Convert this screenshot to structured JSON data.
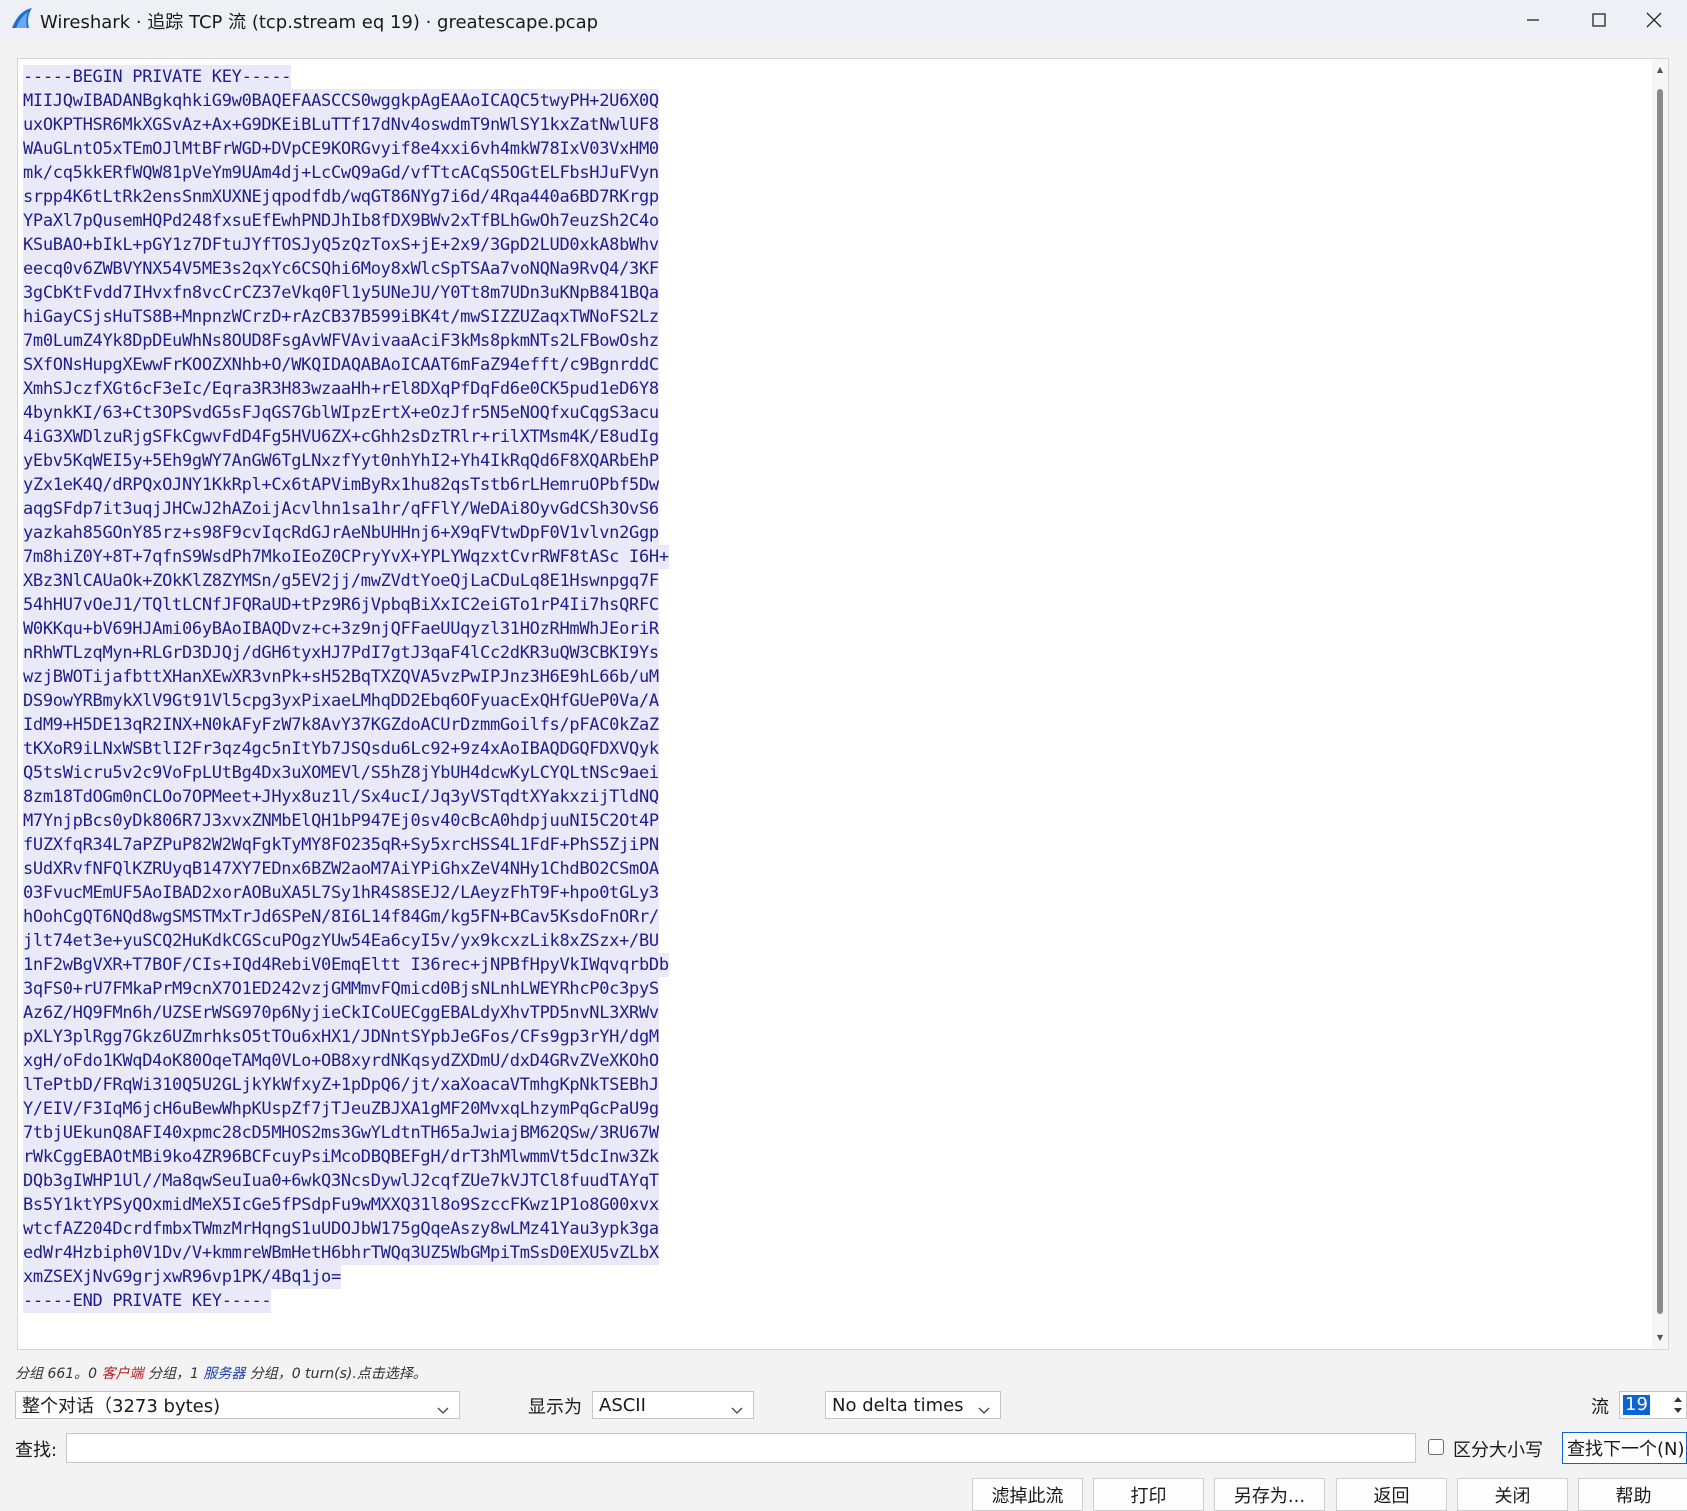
{
  "window": {
    "title": "Wireshark · 追踪 TCP 流 (tcp.stream eq 19) · greatescape.pcap",
    "minimize_icon": "minimize-icon",
    "maximize_icon": "maximize-icon",
    "close_icon": "close-icon",
    "app_icon": "wireshark-fin-icon"
  },
  "stream_lines": [
    "-----BEGIN PRIVATE KEY-----",
    "MIIJQwIBADANBgkqhkiG9w0BAQEFAASCCS0wggkpAgEAAoICAQC5twyPH+2U6X0Q",
    "uxOKPTHSR6MkXGSvAz+Ax+G9DKEiBLuTTf17dNv4oswdmT9nWlSY1kxZatNwlUF8",
    "WAuGLntO5xTEmOJlMtBFrWGD+DVpCE9KORGvyif8e4xxi6vh4mkW78IxV03VxHM0",
    "mk/cq5kkERfWQW81pVeYm9UAm4dj+LcCwQ9aGd/vfTtcACqS5OGtELFbsHJuFVyn",
    "srpp4K6tLtRk2ensSnmXUXNEjqpodfdb/wqGT86NYg7i6d/4Rqa440a6BD7RKrgp",
    "YPaXl7pQusemHQPd248fxsuEfEwhPNDJhIb8fDX9BWv2xTfBLhGwOh7euzSh2C4o",
    "KSuBAO+bIkL+pGY1z7DFtuJYfTOSJyQ5zQzToxS+jE+2x9/3GpD2LUD0xkA8bWhv",
    "eecq0v6ZWBVYNX54V5ME3s2qxYc6CSQhi6Moy8xWlcSpTSAa7voNQNa9RvQ4/3KF",
    "3gCbKtFvdd7IHvxfn8vcCrCZ37eVkq0Fl1y5UNeJU/Y0Tt8m7UDn3uKNpB841BQa",
    "hiGayCSjsHuTS8B+MnpnzWCrzD+rAzCB37B599iBK4t/mwSIZZUZaqxTWNoFS2Lz",
    "7m0LumZ4Yk8DpDEuWhNs8OUD8FsgAvWFVAvivaaAciF3kMs8pkmNTs2LFBowOshz",
    "SXfONsHupgXEwwFrKOOZXNhb+O/WKQIDAQABAoICAAT6mFaZ94efft/c9BgnrddC",
    "XmhSJczfXGt6cF3eIc/Eqra3R3H83wzaaHh+rEl8DXqPfDqFd6e0CK5pud1eD6Y8",
    "4bynkKI/63+Ct3OPSvdG5sFJqGS7GblWIpzErtX+eOzJfr5N5eNOQfxuCqgS3acu",
    "4iG3XWDlzuRjgSFkCgwvFdD4Fg5HVU6ZX+cGhh2sDzTRlr+rilXTMsm4K/E8udIg",
    "yEbv5KqWEI5y+5Eh9gWY7AnGW6TgLNxzfYyt0nhYhI2+Yh4IkRqQd6F8XQARbEhP",
    "yZx1eK4Q/dRPQxOJNY1KkRpl+Cx6tAPVimByRx1hu82qsTstb6rLHemruOPbf5Dw",
    "aqgSFdp7it3uqjJHCwJ2hAZoijAcvlhn1sa1hr/qFFlY/WeDAi8OyvGdCSh3OvS6",
    "yazkah85GOnY85rz+s98F9cvIqcRdGJrAeNbUHHnj6+X9qFVtwDpF0V1vlvn2Ggp",
    "7m8hiZ0Y+8T+7qfnS9WsdPh7MkoIEoZ0CPryYvX+YPLYWqzxtCvrRWF8tASc I6H+",
    "XBz3NlCAUaOk+ZOkKlZ8ZYMSn/g5EV2jj/mwZVdtYoeQjLaCDuLq8E1Hswnpgq7F",
    "54hHU7vOeJ1/TQltLCNfJFQRaUD+tPz9R6jVpbqBiXxIC2eiGTo1rP4Ii7hsQRFC",
    "W0KKqu+bV69HJAmi06yBAoIBAQDvz+c+3z9njQFFaeUUqyzl31HOzRHmWhJEoriR",
    "nRhWTLzqMyn+RLGrD3DJQj/dGH6tyxHJ7PdI7gtJ3qaF4lCc2dKR3uQW3CBKI9Ys",
    "wzjBWOTijafbttXHanXEwXR3vnPk+sH52BqTXZQVA5vzPwIPJnz3H6E9hL66b/uM",
    "DS9owYRBmykXlV9Gt91Vl5cpg3yxPixaeLMhqDD2Ebq6OFyuacExQHfGUeP0Va/A",
    "IdM9+H5DE13qR2INX+N0kAFyFzW7k8AvY37KGZdoACUrDzmmGoilfs/pFAC0kZaZ",
    "tKXoR9iLNxWSBtlI2Fr3qz4gc5nItYb7JSQsdu6Lc92+9z4xAoIBAQDGQFDXVQyk",
    "Q5tsWicru5v2c9VoFpLUtBg4Dx3uXOMEVl/S5hZ8jYbUH4dcwKyLCYQLtNSc9aei",
    "8zm18TdOGm0nCLOo7OPMeet+JHyx8uz1l/Sx4ucI/Jq3yVSTqdtXYakxzijTldNQ",
    "M7YnjpBcs0yDk806R7J3xvxZNMbElQH1bP947Ej0sv40cBcA0hdpjuuNI5C2Ot4P",
    "fUZXfqR34L7aPZPuP82W2WqFgkTyMY8FO235qR+Sy5xrcHSS4L1FdF+PhS5ZjiPN",
    "sUdXRvfNFQlKZRUyqB147XY7EDnx6BZW2aoM7AiYPiGhxZeV4NHy1ChdBO2CSmOA",
    "03FvucMEmUF5AoIBAD2xorAOBuXA5L7Sy1hR4S8SEJ2/LAeyzFhT9F+hpo0tGLy3",
    "hOohCgQT6NQd8wgSMSTMxTrJd6SPeN/8I6L14f84Gm/kg5FN+BCav5KsdoFnORr/",
    "jlt74et3e+yuSCQ2HuKdkCGScuPOgzYUw54Ea6cyI5v/yx9kcxzLik8xZSzx+/BU",
    "1nF2wBgVXR+T7BOF/CIs+IQd4RebiV0EmqEltt I36rec+jNPBfHpyVkIWqvqrbDb",
    "3qFS0+rU7FMkaPrM9cnX7O1ED242vzjGMMmvFQmicd0BjsNLnhLWEYRhcP0c3pyS",
    "Az6Z/HQ9FMn6h/UZSErWSG970p6NyjieCkICoUECggEBALdyXhvTPD5nvNL3XRWv",
    "pXLY3plRgg7Gkz6UZmrhksO5tTOu6xHX1/JDNntSYpbJeGFos/CFs9gp3rYH/dgM",
    "xgH/oFdo1KWqD4oK80OqeTAMq0VLo+OB8xyrdNKqsydZXDmU/dxD4GRvZVeXKOhO",
    "lTePtbD/FRqWi310Q5U2GLjkYkWfxyZ+1pDpQ6/jt/xaXoacaVTmhgKpNkTSEBhJ",
    "Y/EIV/F3IqM6jcH6uBewWhpKUspZf7jTJeuZBJXA1gMF20MvxqLhzymPqGcPaU9g",
    "7tbjUEkunQ8AFI40xpmc28cD5MHOS2ms3GwYLdtnTH65aJwiajBM62QSw/3RU67W",
    "rWkCggEBAOtMBi9ko4ZR96BCFcuyPsiMcoDBQBEFgH/drT3hMlwmmVt5dcInw3Zk",
    "DQb3gIWHP1Ul//Ma8qwSeuIua0+6wkQ3NcsDywlJ2cqfZUe7kVJTCl8fuudTAYqT",
    "Bs5Y1ktYPSyQOxmidMeX5IcGe5fPSdpFu9wMXXQ31l8o9SzccFKwz1P1o8G00xvx",
    "wtcfAZ204DcrdfmbxTWmzMrHqngS1uUDOJbW175gQqeAszy8wLMz41Yau3ypk3ga",
    "edWr4Hzbiph0V1Dv/V+kmmreWBmHetH6bhrTWQq3UZ5WbGMpiTmSsD0EXU5vZLbX",
    "xmZSEXjNvG9grjxwR96vp1PK/4Bq1jo=",
    "-----END PRIVATE KEY-----"
  ],
  "status": {
    "p1": "分组 661。0 ",
    "client": "客户端",
    "p2": " 分组，1 ",
    "server": "服务器",
    "p3": " 分组，0 turn(s).点击选择。"
  },
  "controls": {
    "conversation": "整个对话（3273 bytes)",
    "show_as_label": "显示为",
    "show_as_value": "ASCII",
    "delta": "No delta times",
    "stream_label": "流",
    "stream_value": "19",
    "find_label": "查找:",
    "find_value": "",
    "case_label": "区分大小写",
    "find_next": "查找下一个(N)"
  },
  "buttons": {
    "filter_out": "滤掉此流",
    "print": "打印",
    "save_as": "另存为...",
    "back": "返回",
    "close": "关闭",
    "help": "帮助"
  },
  "colors": {
    "stream_bg": "#e9e9f9",
    "stream_text": "#1d1d8c",
    "client": "#b52020",
    "server": "#1b3fb5",
    "accent": "#0a64d6"
  }
}
